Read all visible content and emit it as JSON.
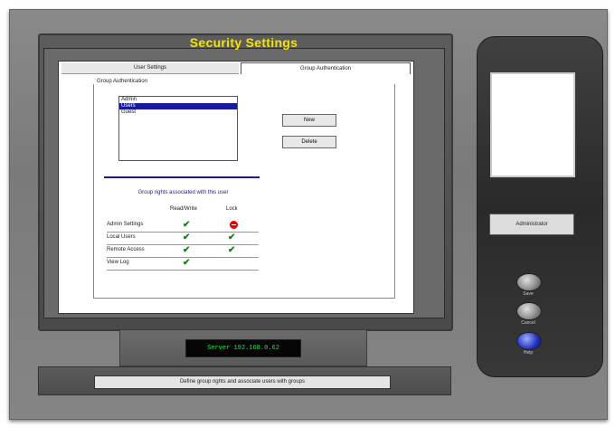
{
  "window": {
    "title": "Security Settings"
  },
  "tabs": [
    {
      "label": "User Settings",
      "active": false
    },
    {
      "label": "Group Authentication",
      "active": true
    }
  ],
  "group_box": {
    "label": "Group Authentication"
  },
  "groups_list": [
    {
      "label": "Admin",
      "selected": false
    },
    {
      "label": "Users",
      "selected": true
    },
    {
      "label": "Guest",
      "selected": false
    }
  ],
  "buttons": {
    "new": "New",
    "delete": "Delete"
  },
  "permissions": {
    "caption": "Group rights associated with this user",
    "columns": [
      "Read/Write",
      "Lock"
    ],
    "rows": [
      {
        "label": "Admin Settings",
        "read_write": "check",
        "lock": "deny"
      },
      {
        "label": "Local Users",
        "read_write": "check",
        "lock": "check"
      },
      {
        "label": "Remote Access",
        "read_write": "check",
        "lock": "check"
      },
      {
        "label": "View Log",
        "read_write": "check",
        "lock": "none"
      }
    ]
  },
  "lcd": {
    "text": "Server 192.168.0.62"
  },
  "status": {
    "text": "Define group rights and associate users with groups"
  },
  "side_panel": {
    "field_text": "Administrator",
    "buttons": [
      {
        "label": "Save"
      },
      {
        "label": "Cancel"
      },
      {
        "label": "Help"
      }
    ]
  },
  "colors": {
    "title": "#f5e300",
    "lcd_text": "#00ff33",
    "selection": "#1a1a9c",
    "check": "#0a8a0a",
    "deny": "#ee0000"
  },
  "icons": {
    "check": "check-icon",
    "deny": "deny-icon"
  }
}
